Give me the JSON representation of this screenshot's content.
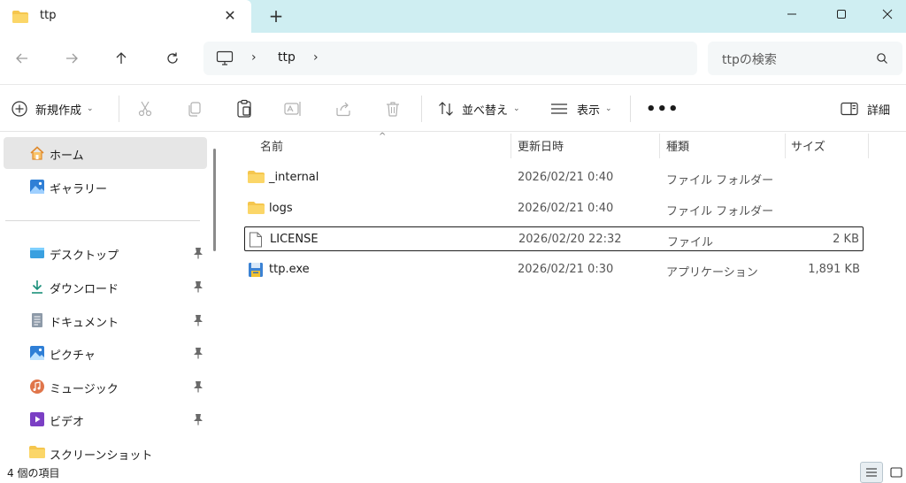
{
  "window": {
    "tab_title": "ttp",
    "tab_close_glyph": "✕",
    "new_tab_glyph": "+"
  },
  "address": {
    "crumbs": [
      "ttp"
    ],
    "separator": "›"
  },
  "search": {
    "placeholder": "ttpの検索"
  },
  "toolbar": {
    "new_label": "新規作成",
    "sort_label": "並べ替え",
    "view_label": "表示",
    "more_label": "•••",
    "details_label": "詳細",
    "chevron": "⌄"
  },
  "sidebar": {
    "items": [
      {
        "label": "ホーム",
        "icon": "home-icon",
        "pinned": false
      },
      {
        "label": "ギャラリー",
        "icon": "gallery-icon",
        "pinned": false
      },
      {
        "label": "デスクトップ",
        "icon": "desktop-icon",
        "pinned": true
      },
      {
        "label": "ダウンロード",
        "icon": "download-icon",
        "pinned": true
      },
      {
        "label": "ドキュメント",
        "icon": "document-icon",
        "pinned": true
      },
      {
        "label": "ピクチャ",
        "icon": "pictures-icon",
        "pinned": true
      },
      {
        "label": "ミュージック",
        "icon": "music-icon",
        "pinned": true
      },
      {
        "label": "ビデオ",
        "icon": "video-icon",
        "pinned": true
      },
      {
        "label": "スクリーンショット",
        "icon": "folder-icon",
        "pinned": false
      }
    ]
  },
  "files": {
    "columns": [
      "名前",
      "更新日時",
      "種類",
      "サイズ"
    ],
    "sort_indicator": "^",
    "rows": [
      {
        "name": "_internal",
        "modified": "2026/02/21 0:40",
        "type": "ファイル フォルダー",
        "size": "",
        "icon": "folder-icon"
      },
      {
        "name": "logs",
        "modified": "2026/02/21 0:40",
        "type": "ファイル フォルダー",
        "size": "",
        "icon": "folder-icon"
      },
      {
        "name": "LICENSE",
        "modified": "2026/02/20 22:32",
        "type": "ファイル",
        "size": "2 KB",
        "icon": "file-icon"
      },
      {
        "name": "ttp.exe",
        "modified": "2026/02/21 0:30",
        "type": "アプリケーション",
        "size": "1,891 KB",
        "icon": "exe-icon"
      }
    ]
  },
  "status": {
    "item_count": "4 個の項目"
  },
  "colors": {
    "titlebar_bg": "#cfeef2",
    "folder_yellow": "#f5c64e",
    "selection_bg": "#e6e6e6",
    "accent_blue": "#2f7fd6"
  }
}
